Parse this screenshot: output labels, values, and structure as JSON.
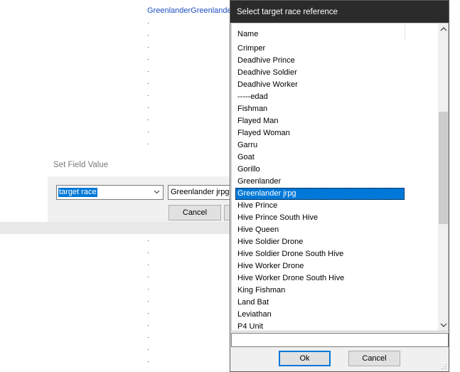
{
  "background": {
    "top_text": "GreenlanderGreenlander",
    "set_field_value": {
      "title": "Set Field Value",
      "field_select": "target race",
      "value": "Greenlander jrpg",
      "cancel_label": "Cancel"
    }
  },
  "dialog": {
    "title": "Select target race reference",
    "column_header": "Name",
    "items": [
      "Crimper",
      "Deadhive Prince",
      "Deadhive Soldier",
      "Deadhive Worker",
      "-----edad",
      "Fishman",
      "Flayed Man",
      "Flayed Woman",
      "Garru",
      "Goat",
      "Gorillo",
      "Greenlander",
      "Greenlander jrpg",
      "Hive Prince",
      "Hive Prince South Hive",
      "Hive Queen",
      "Hive Soldier Drone",
      "Hive Soldier Drone South Hive",
      "Hive Worker Drone",
      "Hive Worker Drone South Hive",
      "King Fishman",
      "Land Bat",
      "Leviathan",
      "P4 Unit"
    ],
    "selected_item": "Greenlander jrpg",
    "filter_value": "",
    "ok_label": "Ok",
    "cancel_label": "Cancel"
  },
  "colors": {
    "selection": "#0078d7",
    "title_bar": "#2b2b2b",
    "link_text": "#1e4fc2"
  }
}
